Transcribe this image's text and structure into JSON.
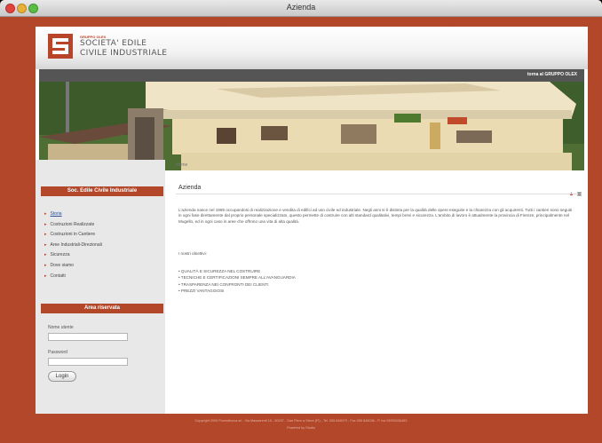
{
  "window": {
    "title": "Azienda"
  },
  "header": {
    "logo_sup": "GRUPPO OLEX",
    "logo_line1": "SOCIETA' EDILE",
    "logo_line2": "CIVILE INDUSTRIALE",
    "top_link": "torna al GRUPPO OLEX"
  },
  "breadcrumb": "Home",
  "sidebar": {
    "menu_title": "Soc. Edile Civile Industriale",
    "items": [
      {
        "label": "Storia",
        "active": true
      },
      {
        "label": "Costruzioni Realizzate"
      },
      {
        "label": "Costruzioni in Cantiere"
      },
      {
        "label": "Aree Industriali-Direzionali"
      },
      {
        "label": "Sicurezza"
      },
      {
        "label": "Dove siamo"
      },
      {
        "label": "Contatti"
      }
    ],
    "reserved_title": "Area riservata",
    "username_label": "Nome utente",
    "password_label": "Password",
    "login_label": "Login"
  },
  "content": {
    "title": "Azienda",
    "paragraph": "L'azienda nasce nel 1969 occupandosi di realizzazione e vendita di edifici ad uso civile ed industriale. Negli anni si è distinta per la qualità delle opere eseguite e la chiarezza con gli acquirenti. Tutti i cantieri sono seguiti in ogni fase direttamente dal proprio personale specializzato, questo permette di costruire con alti standard qualitativi, tempi brevi e sicurezza. L'ambito di lavoro è attualmente la provincia di Firenze, principalmente nel Mugello, ed in ogni caso in aree che offrono una vita di alta qualità.",
    "objectives_title": "I nostri obiettivi:",
    "objectives": [
      "• QUALITÀ E SICUREZZA NEL COSTRUIRE",
      "• TECNICHE E CERTIFICAZIONI SEMPRE ALL'AVANGUARDIA",
      "• TRASPARENZA NEI CONFRONTI DEI CLIENTI",
      "• PREZZI VANTAGGIOSI"
    ]
  },
  "footer": {
    "line1": "Copyright 2009 Fiorentinova srl - Via Massarenti 15 - 50037 - San Piero a Sieve (FI) - Tel. 055 848079 - Fax 055 848036 - P. iva 05993436483",
    "line2": "Powered by Studio"
  },
  "colors": {
    "accent": "#b2472a",
    "topbar": "#555555"
  }
}
